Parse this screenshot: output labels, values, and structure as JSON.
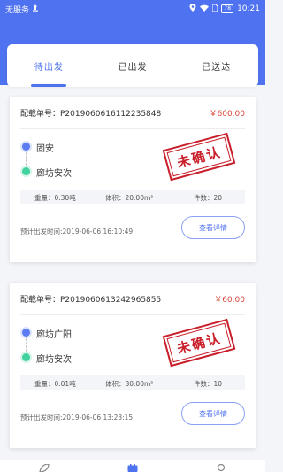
{
  "status_bar": {
    "carrier": "无服务",
    "battery": "78",
    "time": "10:21"
  },
  "tabs": [
    {
      "label": "待出发",
      "active": true
    },
    {
      "label": "已出发",
      "active": false
    },
    {
      "label": "已送达",
      "active": false
    }
  ],
  "orders": [
    {
      "order_label": "配载单号：P2019060616112235848",
      "price": "￥600.00",
      "from": "固安",
      "to": "廊坊安次",
      "stamp": "未确认",
      "weight": "重量：0.30吨",
      "volume": "体积：20.00m³",
      "pieces": "件数：20",
      "depart": "预计出发时间:2019-06-06 16:10:49",
      "detail_label": "查看详情"
    },
    {
      "order_label": "配载单号：P2019060613242965855",
      "price": "￥60.00",
      "from": "廊坊广阳",
      "to": "廊坊安次",
      "stamp": "未确认",
      "weight": "重量：0.01吨",
      "volume": "体积：30.00m³",
      "pieces": "件数：10",
      "depart": "预计出发时间:2019-06-06 13:23:15",
      "detail_label": "查看详情"
    }
  ],
  "bottom_nav": [
    {
      "icon": "leaf-icon",
      "active": false
    },
    {
      "icon": "calendar-icon",
      "active": true
    },
    {
      "icon": "user-icon",
      "active": false
    }
  ],
  "colors": {
    "primary": "#4f72f0",
    "price": "#d9473b",
    "stamp": "#c91f2a",
    "from_dot": "#5b7cf2",
    "to_dot": "#43d39e"
  }
}
